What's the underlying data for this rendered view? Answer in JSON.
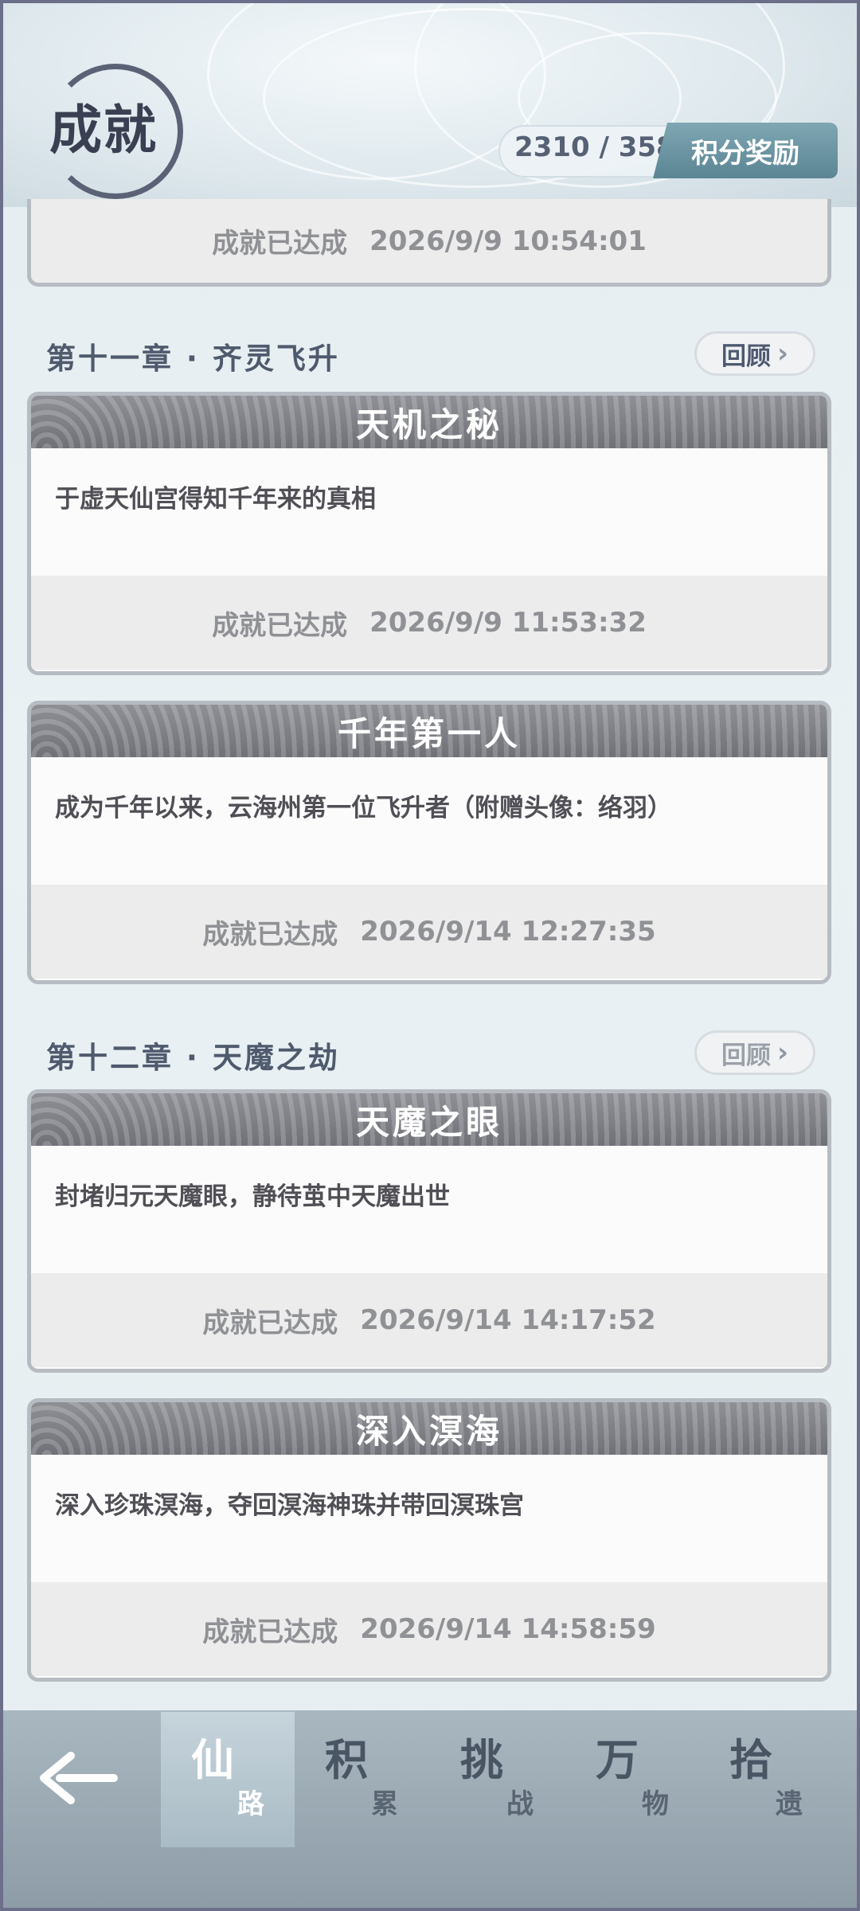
{
  "header": {
    "title": "成就",
    "score": "2310 / 3580",
    "reward_button": "积分奖励"
  },
  "partial_card": {
    "status": "成就已达成",
    "time": "2026/9/9 10:54:01"
  },
  "chapters": [
    {
      "title": "第十一章 · 齐灵飞升",
      "review_label": "回顾",
      "achievements": [
        {
          "name": "天机之秘",
          "desc": "于虚天仙宫得知千年来的真相",
          "status": "成就已达成",
          "time": "2026/9/9 11:53:32"
        },
        {
          "name": "千年第一人",
          "desc": "成为千年以来，云海州第一位飞升者（附赠头像：络羽）",
          "status": "成就已达成",
          "time": "2026/9/14 12:27:35"
        }
      ]
    },
    {
      "title": "第十二章 · 天魔之劫",
      "review_label": "回顾",
      "achievements": [
        {
          "name": "天魔之眼",
          "desc": "封堵归元天魔眼，静待茧中天魔出世",
          "status": "成就已达成",
          "time": "2026/9/14 14:17:52"
        },
        {
          "name": "深入溟海",
          "desc": "深入珍珠溟海，夺回溟海神珠并带回溟珠宫",
          "status": "成就已达成",
          "time": "2026/9/14 14:58:59"
        }
      ]
    }
  ],
  "bottom_tabs": [
    {
      "big": "仙",
      "small": "路",
      "active": true
    },
    {
      "big": "积",
      "small": "累"
    },
    {
      "big": "挑",
      "small": "战"
    },
    {
      "big": "万",
      "small": "物"
    },
    {
      "big": "拾",
      "small": "遗"
    }
  ],
  "icons": {
    "back": "back-arrow-icon",
    "chevron": "chevron-right-icon"
  }
}
